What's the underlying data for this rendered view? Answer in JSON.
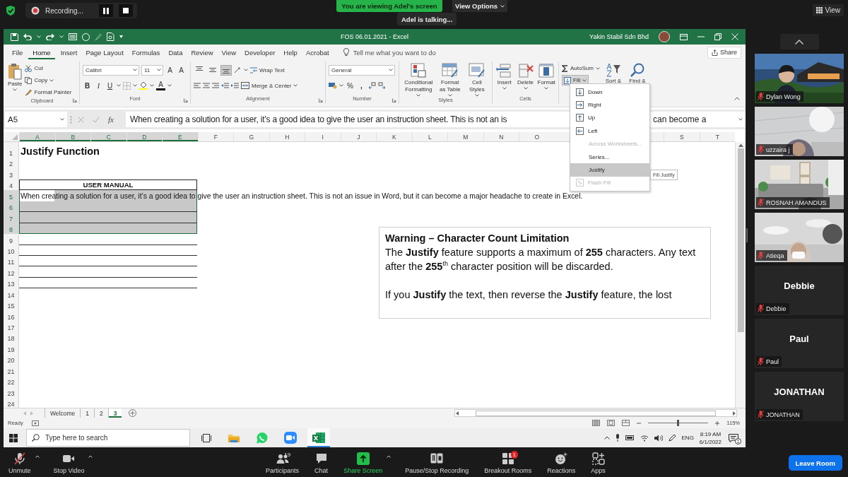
{
  "zoom_top": {
    "recording_label": "Recording...",
    "banner": "You are viewing Adel's screen",
    "view_options": "View Options",
    "talking": "Adel is talking...",
    "view_button": "View"
  },
  "excel": {
    "title": "FOS 06.01.2021 - Excel",
    "account": "Yakin Stabil Sdn Bhd",
    "menu_tabs": [
      {
        "label": "File",
        "selected": false
      },
      {
        "label": "Home",
        "selected": true
      },
      {
        "label": "Insert",
        "selected": false
      },
      {
        "label": "Page Layout",
        "selected": false
      },
      {
        "label": "Formulas",
        "selected": false
      },
      {
        "label": "Data",
        "selected": false
      },
      {
        "label": "Review",
        "selected": false
      },
      {
        "label": "View",
        "selected": false
      },
      {
        "label": "Developer",
        "selected": false
      },
      {
        "label": "Help",
        "selected": false
      },
      {
        "label": "Acrobat",
        "selected": false
      }
    ],
    "tell_me": "Tell me what you want to do",
    "share": "Share",
    "ribbon": [
      {
        "kind": "clipboard",
        "label": "Clipboard",
        "large": "Paste",
        "small": [
          "Cut",
          "Copy",
          "Format Painter"
        ]
      },
      {
        "kind": "font",
        "label": "Font",
        "font_name": "Calibri",
        "font_size": "11",
        "size_buttons": [
          "A",
          "A"
        ],
        "styles": [
          "B",
          "I",
          "U"
        ],
        "color_letter": "A"
      },
      {
        "kind": "alignment",
        "label": "Alignment",
        "align_buttons": [
          {
            "kind": "top",
            "selected": false
          },
          {
            "kind": "middle",
            "selected": false
          },
          {
            "kind": "bottom",
            "selected": true
          }
        ],
        "wrap": "Wrap Text",
        "merge": "Merge & Center"
      },
      {
        "kind": "number",
        "label": "Number",
        "format": "General",
        "percent": "%",
        "comma": ","
      },
      {
        "kind": "styles",
        "label": "Styles",
        "large": [
          "Conditional Formatting",
          "Format as Table",
          "Cell Styles"
        ]
      },
      {
        "kind": "cells",
        "label": "Cells",
        "large": [
          "Insert",
          "Delete",
          "Format"
        ]
      },
      {
        "kind": "editing",
        "autosum": "AutoSum",
        "fill": "Fill",
        "fill_pressed": true,
        "large": [
          "Sort &",
          "Find &"
        ]
      }
    ],
    "formula_bar": {
      "name_box": "A5",
      "fx": "fx",
      "content": "When creating a solution for a user, it’s a good idea to give the user an instruction sheet. This is not an is",
      "content_tail": "can become a"
    },
    "columns": [
      {
        "label": "A",
        "selected": true
      },
      {
        "label": "B",
        "selected": true
      },
      {
        "label": "C",
        "selected": true
      },
      {
        "label": "D",
        "selected": true
      },
      {
        "label": "E",
        "selected": true
      },
      {
        "label": "F",
        "selected": false
      },
      {
        "label": "G",
        "selected": false
      },
      {
        "label": "H",
        "selected": false
      },
      {
        "label": "I",
        "selected": false
      },
      {
        "label": "J",
        "selected": false
      },
      {
        "label": "K",
        "selected": false
      },
      {
        "label": "L",
        "selected": false
      },
      {
        "label": "M",
        "selected": false
      },
      {
        "label": "N",
        "selected": false
      },
      {
        "label": "O",
        "selected": false
      }
    ],
    "columns_after_menu": [
      {
        "label": "S",
        "selected": false
      },
      {
        "label": "T",
        "selected": false
      }
    ],
    "rows": [
      {
        "number": "1",
        "kind": "title",
        "text": "Justify Function",
        "selected": false
      },
      {
        "number": "2",
        "kind": "empty",
        "selected": false
      },
      {
        "number": "3",
        "kind": "empty",
        "selected": false
      },
      {
        "number": "4",
        "kind": "header",
        "text": "USER MANUAL",
        "selected": false
      },
      {
        "number": "5",
        "kind": "body",
        "text": "When creating a solution for a user, it’s a good idea to give the user an instruction sheet. This is not an issue in Word, but it can become a major headache to create in Excel.",
        "selected": true
      },
      {
        "number": "6",
        "kind": "filled",
        "selected": true
      },
      {
        "number": "7",
        "kind": "filled",
        "selected": true
      },
      {
        "number": "8",
        "kind": "filled",
        "selected": true
      },
      {
        "number": "9",
        "kind": "lined",
        "selected": false
      },
      {
        "number": "10",
        "kind": "lined",
        "selected": false
      },
      {
        "number": "11",
        "kind": "lined",
        "selected": false
      },
      {
        "number": "12",
        "kind": "lined",
        "selected": false
      },
      {
        "number": "13",
        "kind": "lined",
        "selected": false
      },
      {
        "number": "14",
        "kind": "empty",
        "selected": false
      },
      {
        "number": "15",
        "kind": "empty",
        "selected": false
      },
      {
        "number": "16",
        "kind": "empty",
        "selected": false
      },
      {
        "number": "17",
        "kind": "empty",
        "selected": false
      },
      {
        "number": "18",
        "kind": "empty",
        "selected": false
      },
      {
        "number": "19",
        "kind": "empty",
        "selected": false
      },
      {
        "number": "20",
        "kind": "empty",
        "selected": false
      },
      {
        "number": "21",
        "kind": "empty",
        "selected": false
      },
      {
        "number": "22",
        "kind": "empty",
        "selected": false
      },
      {
        "number": "23",
        "kind": "empty",
        "selected": false
      },
      {
        "number": "24",
        "kind": "empty",
        "selected": false
      }
    ],
    "text_box": {
      "title": "Warning – Character Count Limitation",
      "paragraphs": [
        "The **Justify** feature supports a maximum of **255** characters.  Any text after the **255**$^{th}$ character position will be discarded.",
        "If you **Justify** the text, then reverse the **Justify** feature, the lost"
      ]
    },
    "fill_menu": [
      {
        "label": "Down",
        "kind": "down",
        "disabled": false,
        "selected": false
      },
      {
        "label": "Right",
        "kind": "right",
        "disabled": false,
        "selected": false
      },
      {
        "label": "Up",
        "kind": "up",
        "disabled": false,
        "selected": false
      },
      {
        "label": "Left",
        "kind": "left",
        "disabled": false,
        "selected": false
      },
      {
        "label": "Across Worksheets...",
        "kind": "none",
        "disabled": true,
        "selected": false
      },
      {
        "label": "Series...",
        "kind": "none",
        "disabled": false,
        "selected": false
      },
      {
        "label": "Justify",
        "kind": "none",
        "disabled": false,
        "selected": true
      },
      {
        "label": "Flash Fill",
        "kind": "flash",
        "disabled": true,
        "selected": false
      }
    ],
    "tooltip": "Fill Justify",
    "sheet_tabs": [
      {
        "label": "Welcome",
        "selected": false
      },
      {
        "label": "1",
        "selected": false
      },
      {
        "label": "2",
        "selected": false
      },
      {
        "label": "3",
        "selected": true
      }
    ],
    "status": {
      "ready": "Ready",
      "zoom": "115%",
      "level": 0.5
    }
  },
  "taskbar": {
    "search_placeholder": "Type here to search",
    "apps": [
      {
        "kind": "explorer",
        "selected": false
      },
      {
        "kind": "whatsapp",
        "selected": false
      },
      {
        "kind": "zoom",
        "selected": false
      },
      {
        "kind": "excel",
        "selected": true
      }
    ],
    "language": "ENG",
    "time": "8:19 AM",
    "date": "6/1/2022",
    "notifications": "1"
  },
  "participants": [
    {
      "name": "Dylan Wong",
      "kind": "video",
      "muted": true
    },
    {
      "name": "uzzaira j",
      "kind": "video",
      "muted": true
    },
    {
      "name": "ROSNAH AMANDUS",
      "kind": "video",
      "muted": true
    },
    {
      "name": "Atieqa",
      "kind": "video",
      "muted": true
    },
    {
      "name": "Debbie",
      "kind": "name",
      "display": "Debbie",
      "muted": true
    },
    {
      "name": "Paul",
      "kind": "name",
      "display": "Paul",
      "muted": true
    },
    {
      "name": "JONATHAN",
      "kind": "name",
      "display": "JONATHAN",
      "muted": true
    }
  ],
  "leave": "Leave Room",
  "toolbar": [
    {
      "label": "Unmute",
      "kind": "mic"
    },
    {
      "label": "Stop Video",
      "kind": "video"
    },
    {
      "label": "Participants",
      "kind": "participants",
      "count": "19"
    },
    {
      "label": "Chat",
      "kind": "chat"
    },
    {
      "label": "Share Screen",
      "kind": "share"
    },
    {
      "label": "Pause/Stop Recording",
      "kind": "record"
    },
    {
      "label": "Breakout Rooms",
      "kind": "breakout",
      "badge": "1"
    },
    {
      "label": "Reactions",
      "kind": "reactions"
    },
    {
      "label": "Apps",
      "kind": "apps"
    }
  ]
}
